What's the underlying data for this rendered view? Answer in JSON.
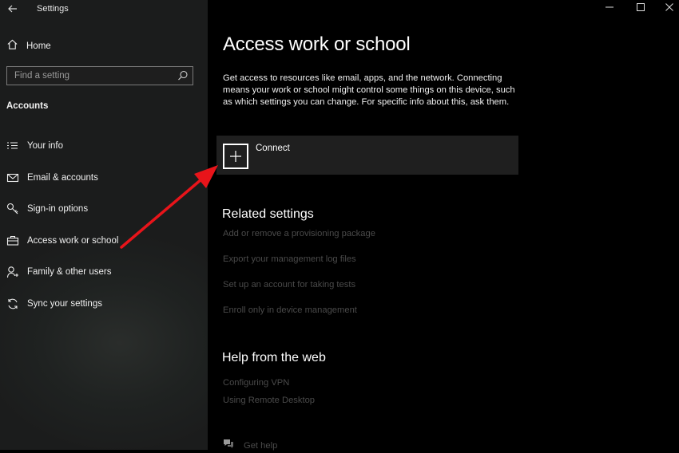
{
  "window": {
    "title": "Settings"
  },
  "sidebar": {
    "home_label": "Home",
    "search_placeholder": "Find a setting",
    "section_title": "Accounts",
    "items": [
      {
        "label": "Your info",
        "icon": "person-card-icon"
      },
      {
        "label": "Email & accounts",
        "icon": "mail-icon"
      },
      {
        "label": "Sign-in options",
        "icon": "key-icon"
      },
      {
        "label": "Access work or school",
        "icon": "briefcase-icon"
      },
      {
        "label": "Family & other users",
        "icon": "person-add-icon"
      },
      {
        "label": "Sync your settings",
        "icon": "sync-icon"
      }
    ]
  },
  "main": {
    "title": "Access work or school",
    "description": "Get access to resources like email, apps, and the network. Connecting means your work or school might control some things on this device, such as which settings you can change. For specific info about this, ask them.",
    "connect_label": "Connect",
    "related_title": "Related settings",
    "related_links": [
      "Add or remove a provisioning package",
      "Export your management log files",
      "Set up an account for taking tests",
      "Enroll only in device management"
    ],
    "help_title": "Help from the web",
    "help_links": [
      "Configuring VPN",
      "Using Remote Desktop"
    ],
    "get_help_label": "Get help"
  },
  "colors": {
    "sidebar_bg": "#1f2221",
    "main_bg": "#000000",
    "connect_bg": "#1f1f1f",
    "disabled_link": "#4a4a4a",
    "annotation_arrow": "#e8141a"
  }
}
